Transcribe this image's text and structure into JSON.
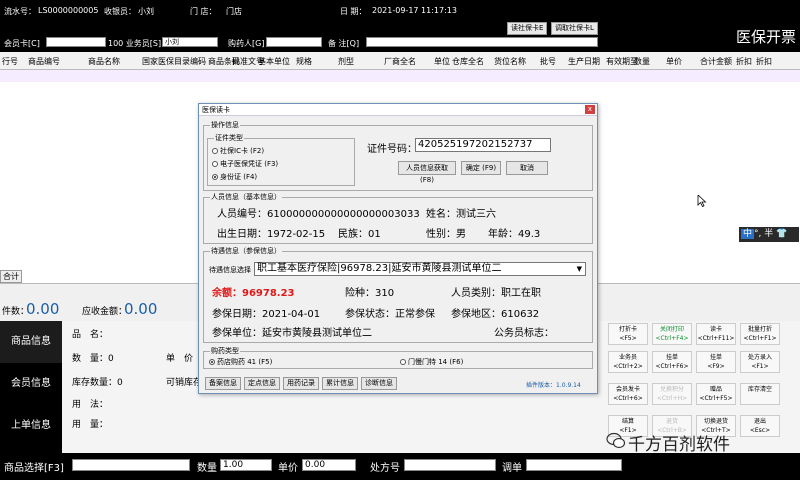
{
  "header": {
    "serial_label": "流水号：",
    "serial_value": "LS0000000005",
    "cashier_label": "收银员：",
    "cashier_value": "小刘",
    "store_label": "门 店：",
    "store_value": "门店",
    "date_label": "日 期：",
    "date_value": "2021-09-17 11:17:13",
    "read_card_btn": "读社保卡E",
    "read_card_btn2": "调取社保卡L",
    "member_card_label": "会员卡[C]",
    "salesman_label": "100 业务员[S]",
    "salesman_value": "小刘",
    "buyer_label": "购药人[G]",
    "note_label": "备 注[Q]",
    "title": "医保开票"
  },
  "grid": {
    "columns": [
      "行号",
      "商品编号",
      "商品名称",
      "国家医保目录编码",
      "商品条码",
      "批准文号",
      "基本单位",
      "规格",
      "剂型",
      "厂商全名",
      "单位",
      "仓库全名",
      "货位名称",
      "批号",
      "生产日期",
      "有效期至",
      "数量",
      "单价",
      "合计金额",
      "折扣",
      "折扣"
    ],
    "total_label": "合计"
  },
  "ime": {
    "zh": "中",
    "rest": "°, 半 👕"
  },
  "mid": {
    "count_label": "件数：",
    "count_value": "0.00",
    "receivable_label": "应收金额：",
    "receivable_value": "0.00"
  },
  "sidebar": [
    {
      "label": "商品信息"
    },
    {
      "label": "会员信息"
    },
    {
      "label": "上单信息"
    }
  ],
  "info": {
    "product_name_label": "品　名：",
    "qty_label": "数　量：0",
    "unit_label": "单　价",
    "stock_label": "库存数量：0",
    "sellable_label": "可销库存",
    "usage_label": "用　法：",
    "dosage_label": "用　量："
  },
  "right_buttons": [
    {
      "l1": "打折卡",
      "l2": "<F5>",
      "style": ""
    },
    {
      "l1": "关闭打印",
      "l2": "<Ctrl+F4>",
      "style": "grn"
    },
    {
      "l1": "读卡",
      "l2": "<Ctrl+F11>",
      "style": ""
    },
    {
      "l1": "批量打折",
      "l2": "<Ctrl+F1>",
      "style": ""
    },
    {
      "l1": "业务员",
      "l2": "<Ctrl+2>",
      "style": ""
    },
    {
      "l1": "挂单",
      "l2": "<Ctrl+F6>",
      "style": ""
    },
    {
      "l1": "挂单",
      "l2": "<F9>",
      "style": ""
    },
    {
      "l1": "处方录入",
      "l2": "<F1>",
      "style": ""
    },
    {
      "l1": "会员发卡",
      "l2": "<Ctrl+6>",
      "style": ""
    },
    {
      "l1": "兑换积分",
      "l2": "<Ctrl+H>",
      "style": "g"
    },
    {
      "l1": "赠品",
      "l2": "<Ctrl+F5>",
      "style": ""
    },
    {
      "l1": "库存清空",
      "l2": "",
      "style": ""
    },
    {
      "l1": "结算",
      "l2": "<F1>",
      "style": ""
    },
    {
      "l1": "退货",
      "l2": "<Ctrl+B>",
      "style": "g"
    },
    {
      "l1": "切换退货",
      "l2": "<Ctrl+T>",
      "style": ""
    },
    {
      "l1": "退出",
      "l2": "<Esc>",
      "style": ""
    }
  ],
  "watermark": "千方百剂软件",
  "footer": {
    "product_select_label": "商品选择[F3]",
    "qty_label": "数量",
    "qty_value": "1.00",
    "price_label": "单价",
    "price_value": "0.00",
    "prescription_label": "处方号",
    "order_label": "调单"
  },
  "dialog": {
    "title": "医保读卡",
    "close": "x",
    "op_group": "操作信息",
    "cert_group": "证件类型",
    "radio1": "社保IC卡 (F2)",
    "radio2": "电子医保凭证 (F3)",
    "radio3": "身份证 (F4)",
    "cert_no_label": "证件号码：",
    "cert_no_value": "420525197202152737",
    "btn_fetch": "人员信息获取 (F8)",
    "btn_ok": "确定 (F9)",
    "btn_cancel": "取消",
    "person_group": "人员信息（基本信息）",
    "person_no": "人员编号：610000000000000000003033",
    "name": "姓名：测试三六",
    "birth": "出生日期：1972-02-15",
    "nation": "民族：01",
    "gender": "性别：男",
    "age": "年龄：49.3",
    "benefit_group": "待遇信息（参保信息）",
    "benefit_select_label": "待遇信息选择",
    "benefit_select_value": "职工基本医疗保险|96978.23|延安市黄陵县测试单位二",
    "balance": "余额：96978.23",
    "insurance_type": "险种：310",
    "person_type": "人员类别：职工在职",
    "insured_date": "参保日期：2021-04-01",
    "insured_status": "参保状态：正常参保",
    "insured_area": "参保地区：610632",
    "insured_unit": "参保单位：延安市黄陵县测试单位二",
    "civil_servant": "公务员标志：",
    "buy_group": "购药类型",
    "buy_radio1": "药店购药 41 (F5)",
    "buy_radio2": "门慢门特 14 (F6)",
    "tabs": [
      "备案信息",
      "定点信息",
      "用药记录",
      "累计信息",
      "诊断信息"
    ],
    "version": "插件版本：1.0.9.14"
  }
}
